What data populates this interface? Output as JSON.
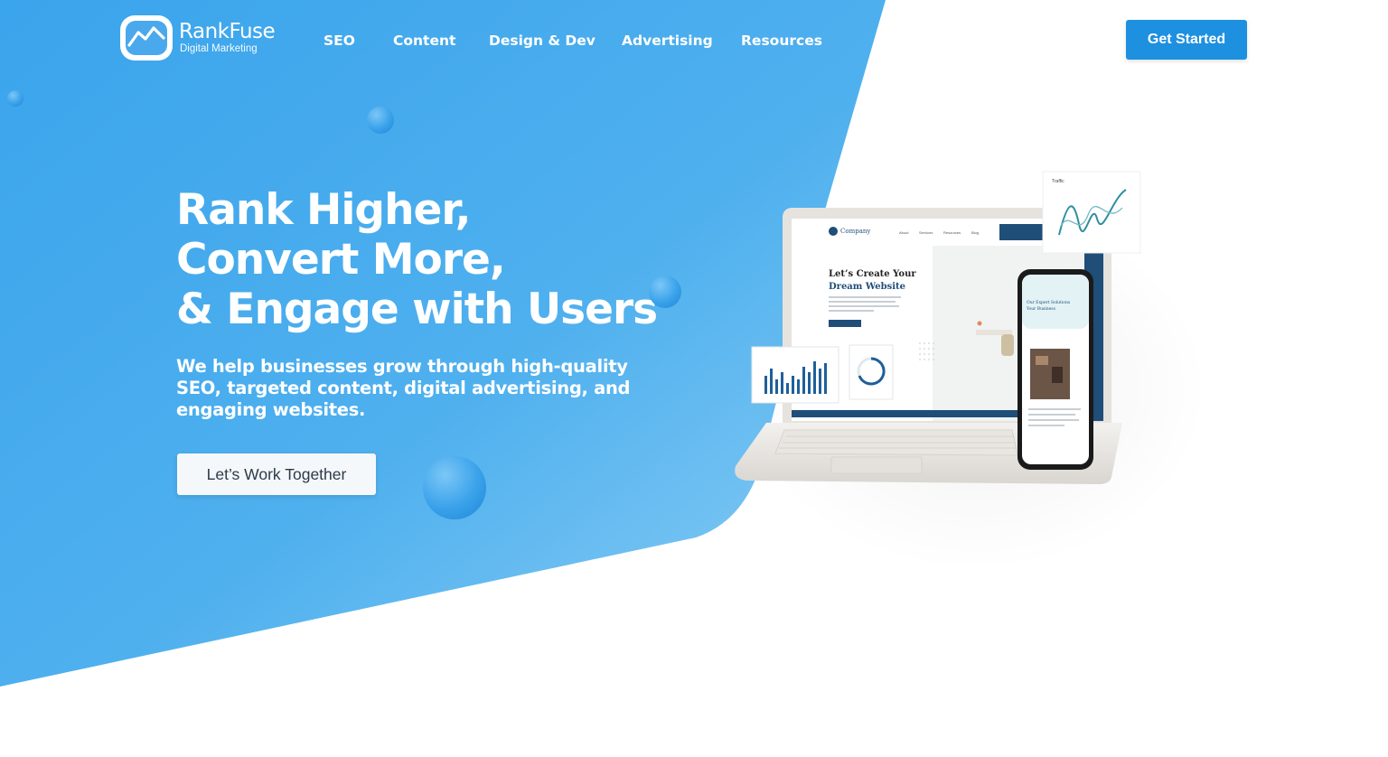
{
  "brand": {
    "name": "RankFuse",
    "tagline": "Digital Marketing"
  },
  "nav": {
    "items": [
      {
        "label": "SEO"
      },
      {
        "label": "Content"
      },
      {
        "label": "Design & Dev"
      },
      {
        "label": "Advertising"
      },
      {
        "label": "Resources"
      }
    ],
    "cta_label": "Get Started"
  },
  "hero": {
    "headline_lines": [
      "Rank Higher,",
      "Convert More,",
      "& Engage with Users"
    ],
    "subcopy": "We help businesses grow through high-quality SEO, targeted content, digital advertising, and engaging websites.",
    "cta_label": "Let’s Work Together"
  },
  "mockup": {
    "site_brand": "Company",
    "site_headline_lines": [
      "Let’s Create Your",
      "Dream Website"
    ],
    "site_nav": [
      "About",
      "Services",
      "Resources",
      "Blog"
    ],
    "phone_heading_lines": [
      "Our Expert Solutions",
      "Your Business"
    ],
    "traffic_card_title": "Traffic"
  },
  "colors": {
    "hero_blue": "#3aa4ec",
    "hero_blue_light": "#7cc8f3",
    "button_blue": "#1e90e0",
    "white": "#ffffff"
  }
}
